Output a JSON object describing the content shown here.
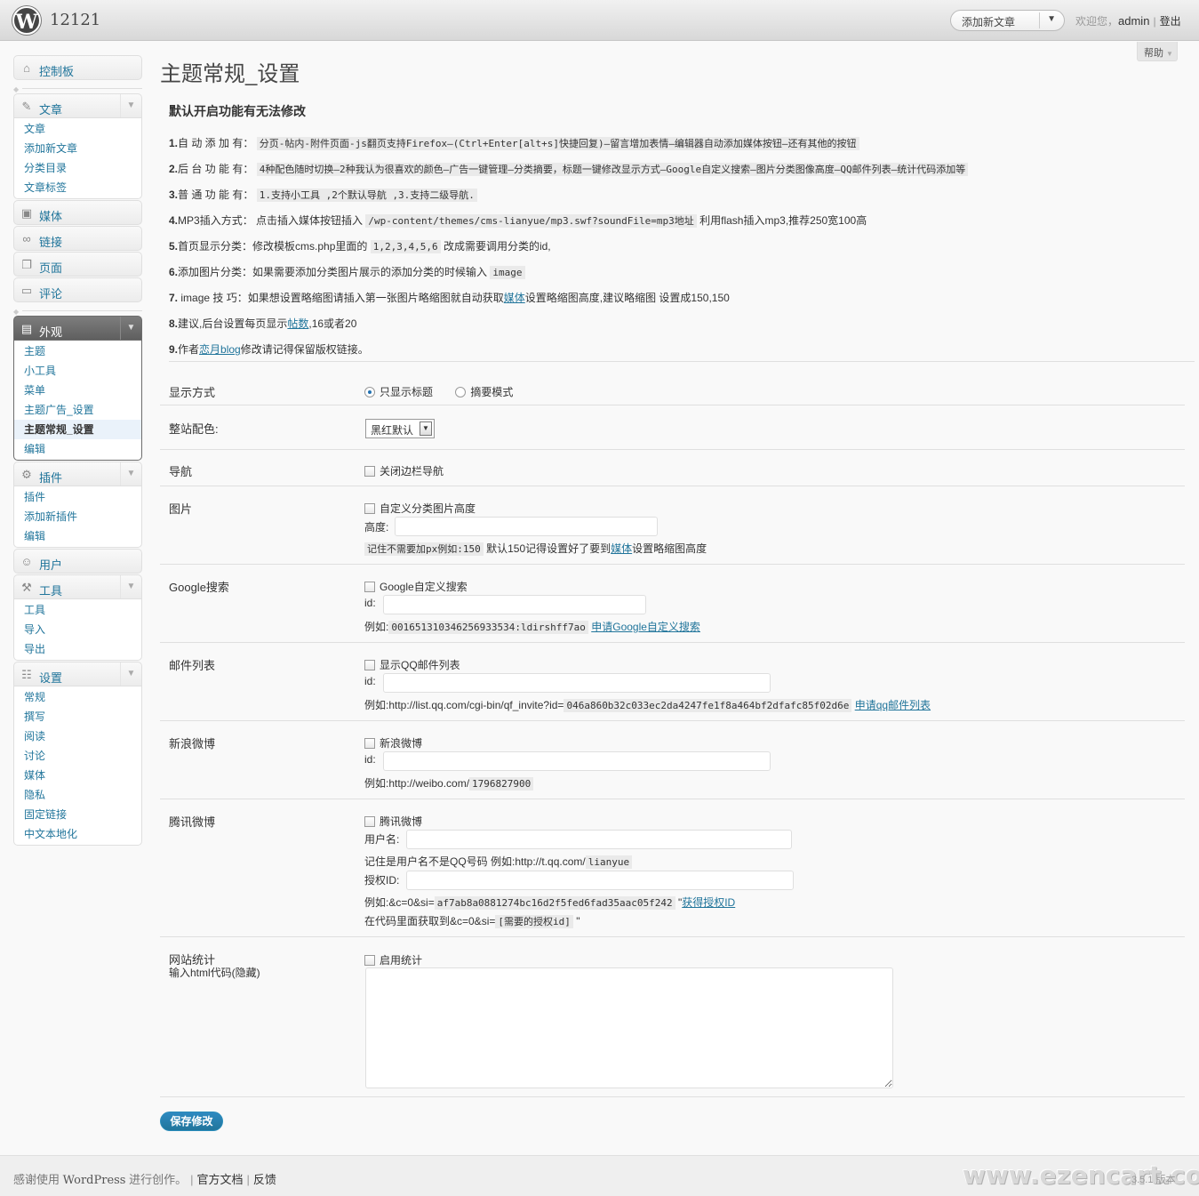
{
  "header": {
    "site_name": "12121",
    "favorite_action": "添加新文章",
    "welcome": "欢迎您，",
    "username": "admin",
    "sep": "|",
    "logout": "登出"
  },
  "help_tab": "帮助",
  "sidebar": {
    "dashboard": "控制板",
    "posts": {
      "label": "文章",
      "items": [
        "文章",
        "添加新文章",
        "分类目录",
        "文章标签"
      ]
    },
    "media": "媒体",
    "links": "链接",
    "pages": "页面",
    "comments": "评论",
    "appearance": {
      "label": "外观",
      "items": [
        "主题",
        "小工具",
        "菜单",
        "主题广告_设置",
        "主题常规_设置",
        "编辑"
      ]
    },
    "plugins": {
      "label": "插件",
      "items": [
        "插件",
        "添加新插件",
        "编辑"
      ]
    },
    "users": "用户",
    "tools": {
      "label": "工具",
      "items": [
        "工具",
        "导入",
        "导出"
      ]
    },
    "settings": {
      "label": "设置",
      "items": [
        "常规",
        "撰写",
        "阅读",
        "讨论",
        "媒体",
        "隐私",
        "固定链接",
        "中文本地化"
      ]
    }
  },
  "page_title": "主题常规_设置",
  "notes": {
    "heading": "默认开启功能有无法修改",
    "n1_label": "1.",
    "n1_key": "自 动 添 加 有：",
    "n1_code": "分页-帖内-附件页面-js翻页支持Firefox—(Ctrl+Enter[alt+s]快捷回复)—留言增加表情—编辑器自动添加媒体按钮—还有其他的按钮",
    "n2_label": "2.",
    "n2_key": "后 台 功 能 有：",
    "n2_code": "4种配色随时切换—2种我认为很喜欢的颜色—广告一键管理—分类摘要，标题一键修改显示方式—Google自定义搜索—图片分类图像高度—QQ邮件列表—统计代码添加等",
    "n3_label": "3.",
    "n3_key": "普 通 功 能 有：",
    "n3_code": "1.支持小工具 ,2个默认导航 ,3.支持二级导航.",
    "n4_label": "4.",
    "n4_key": "MP3插入方式：",
    "n4_pre": "点击插入媒体按钮插入",
    "n4_code": "/wp-content/themes/cms-lianyue/mp3.swf?soundFile=mp3地址",
    "n4_post": "利用flash插入mp3,推荐250宽100高",
    "n5_label": "5.",
    "n5_key": "首页显示分类：",
    "n5_pre": "修改模板cms.php里面的",
    "n5_code": "1,2,3,4,5,6",
    "n5_post": "改成需要调用分类的id,",
    "n6_label": "6.",
    "n6_key": "添加图片分类：",
    "n6_pre": "如果需要添加分类图片展示的添加分类的时候输入",
    "n6_code": "image",
    "n7_label": "7.",
    "n7_key": "image 技 巧：",
    "n7_pre": "如果想设置略缩图请插入第一张图片略缩图就自动获取",
    "n7_link": "媒体",
    "n7_post": "设置略缩图高度,建议略缩图 设置成150,150",
    "n8_label": "8.",
    "n8_pre": "建议,后台设置每页显示",
    "n8_link": "帖数",
    "n8_post": ",16或者20",
    "n9_label": "9.",
    "n9_pre": "作者",
    "n9_link": "恋月blog",
    "n9_post": "修改请记得保留版权链接。"
  },
  "form": {
    "display_mode": {
      "label": "显示方式",
      "opt1": "只显示标题",
      "opt2": "摘要模式",
      "selected": "只显示标题"
    },
    "color_scheme": {
      "label": "整站配色:",
      "value": "黑红默认"
    },
    "nav": {
      "label": "导航",
      "checkbox": "关闭边栏导航"
    },
    "image": {
      "label": "图片",
      "checkbox": "自定义分类图片高度",
      "height_label": "高度:",
      "hint_code": "记住不需要加px例如:150",
      "hint_text": "默认150记得设置好了要到",
      "hint_link": "媒体",
      "hint_post": "设置略缩图高度"
    },
    "google": {
      "label": "Google搜索",
      "checkbox": "Google自定义搜索",
      "id_label": "id:",
      "ex_pre": "例如:",
      "ex_code": "001651310346256933534:ldirshff7ao",
      "ex_link": "申请Google自定义搜索"
    },
    "mail": {
      "label": "邮件列表",
      "checkbox": "显示QQ邮件列表",
      "id_label": "id:",
      "ex_pre": "例如:http://list.qq.com/cgi-bin/qf_invite?id=",
      "ex_code": "046a860b32c033ec2da4247fe1f8a464bf2dfafc85f02d6e",
      "ex_link": "申请qq邮件列表"
    },
    "sina": {
      "label": "新浪微博",
      "checkbox": "新浪微博",
      "id_label": "id:",
      "ex_pre": "例如:http://weibo.com/",
      "ex_code": "1796827900"
    },
    "tencent": {
      "label": "腾讯微博",
      "checkbox": "腾讯微博",
      "user_label": "用户名:",
      "note_pre": "记住是用户名不是QQ号码 例如:http://t.qq.com/",
      "note_code": "lianyue",
      "auth_label": "授权ID:",
      "ex_pre": "例如:&c=0&si=",
      "ex_code": "af7ab8a0881274bc16d2f5fed6fad35aac05f242",
      "ex_quote": "\"",
      "ex_link": "获得授权ID",
      "ex2_pre": "在代码里面获取到&c=0&si=",
      "ex2_code": "[需要的授权id]",
      "ex2_post": "\""
    },
    "stats": {
      "label": "网站统计",
      "sublabel": "输入html代码(隐藏)",
      "checkbox": "启用统计"
    }
  },
  "save_button": "保存修改",
  "footer": {
    "thanks_pre": "感谢使用",
    "wp": "WordPress",
    "thanks_post": "进行创作。",
    "docs": "官方文档",
    "feedback": "反馈",
    "version": "3.5.1 版本",
    "watermark": "www.ezencart.com"
  }
}
